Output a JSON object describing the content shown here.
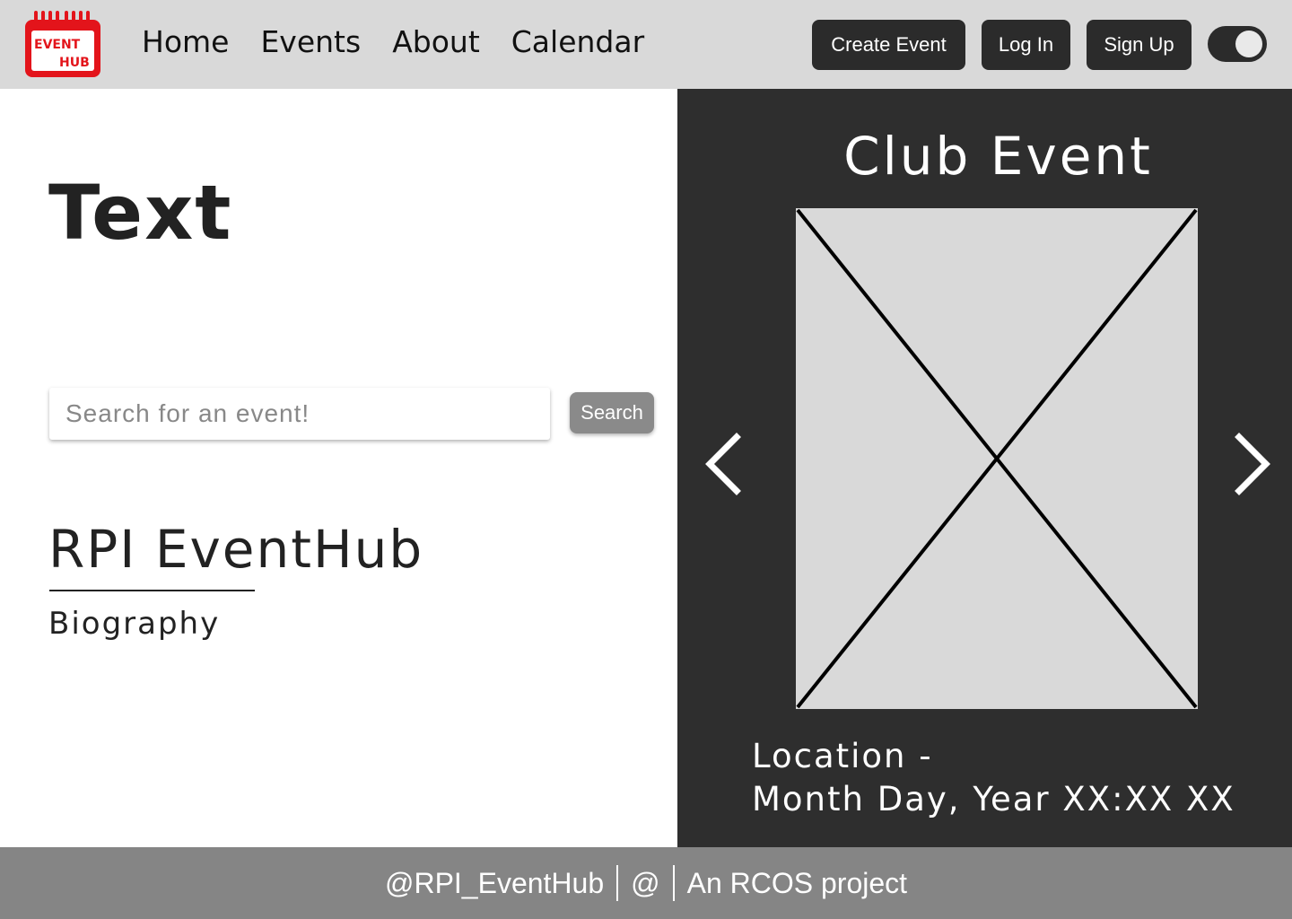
{
  "header": {
    "logo_text_top": "EVENT",
    "logo_text_bottom": "HUB",
    "nav": [
      "Home",
      "Events",
      "About",
      "Calendar"
    ],
    "create_event_label": "Create Event",
    "login_label": "Log In",
    "signup_label": "Sign Up",
    "theme_toggle_on": true
  },
  "hero": {
    "heading": "Text",
    "search_placeholder": "Search for an event!",
    "search_button_label": "Search",
    "org_title": "RPI EventHub",
    "bio_label": "Biography"
  },
  "carousel": {
    "event_title": "Club Event",
    "location_line": "Location -",
    "datetime_line": "Month Day, Year XX:XX XX"
  },
  "footer": {
    "handle": "@RPI_EventHub",
    "at_symbol": "@",
    "project": "An RCOS project"
  },
  "colors": {
    "header_bg": "#d9d9d9",
    "dark_panel": "#2e2e2e",
    "button_dark": "#2b2b2b",
    "logo_red": "#e3141b",
    "footer_bg": "#858585",
    "search_button_bg": "#8a8a8a"
  },
  "icons": [
    "calendar-logo-icon",
    "chevron-left-icon",
    "chevron-right-icon",
    "image-placeholder-icon"
  ]
}
